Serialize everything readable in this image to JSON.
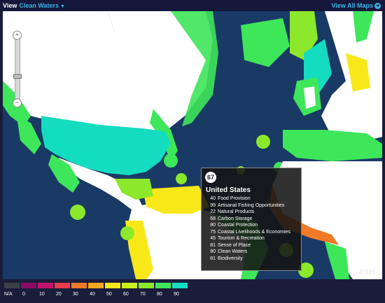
{
  "header": {
    "view_label": "View",
    "selected_view": "Clean Waters",
    "view_all": "View All Maps"
  },
  "zoom": {
    "in": "+",
    "out": "−"
  },
  "popup": {
    "score": "67",
    "country": "United States",
    "rows": [
      {
        "value": "40",
        "label": "Food Provision"
      },
      {
        "value": "99",
        "label": "Artisanal Fishing Opportunities"
      },
      {
        "value": "22",
        "label": "Natural Products"
      },
      {
        "value": "68",
        "label": "Carbon Storage"
      },
      {
        "value": "80",
        "label": "Coastal Protection"
      },
      {
        "value": "75",
        "label": "Coastal Livelihoods & Economies"
      },
      {
        "value": "45",
        "label": "Tourism & Recreation"
      },
      {
        "value": "81",
        "label": "Sense of Place"
      },
      {
        "value": "80",
        "label": "Clean Waters"
      },
      {
        "value": "81",
        "label": "Biodiversity"
      }
    ]
  },
  "attribution": "esri",
  "legend": [
    {
      "label": "N/A",
      "color": "#3a3f4a"
    },
    {
      "label": "0",
      "color": "#8a0a66"
    },
    {
      "label": "10",
      "color": "#c0146a"
    },
    {
      "label": "20",
      "color": "#e63c4a"
    },
    {
      "label": "30",
      "color": "#f07a28"
    },
    {
      "label": "40",
      "color": "#f5a81e"
    },
    {
      "label": "50",
      "color": "#f8e81a"
    },
    {
      "label": "60",
      "color": "#c8f01e"
    },
    {
      "label": "70",
      "color": "#8ce82a"
    },
    {
      "label": "80",
      "color": "#3ee65a"
    },
    {
      "label": "90",
      "color": "#14dcc0"
    }
  ]
}
